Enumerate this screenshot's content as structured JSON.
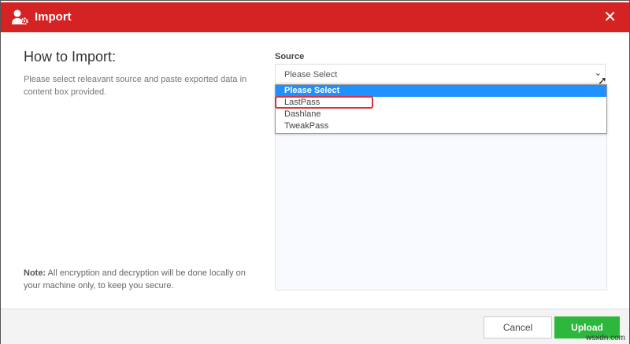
{
  "dialog": {
    "title": "Import",
    "close_icon": "close-icon",
    "title_icon": "user-gear-icon"
  },
  "left": {
    "heading": "How to Import:",
    "description": "Please select releavant source and paste exported data in content box provided.",
    "note_label": "Note:",
    "note_text": " All encryption and decryption will be done locally on your machine only, to keep you secure."
  },
  "source": {
    "label": "Source",
    "selected": "Please Select",
    "options": [
      "Please Select",
      "LastPass",
      "Dashlane",
      "TweakPass"
    ],
    "highlighted_option": "LastPass"
  },
  "footer": {
    "cancel": "Cancel",
    "upload": "Upload"
  },
  "watermark": "wsxdn.com",
  "colors": {
    "header": "#d52222",
    "upload": "#2db83d",
    "option_selected": "#1e90ff"
  }
}
